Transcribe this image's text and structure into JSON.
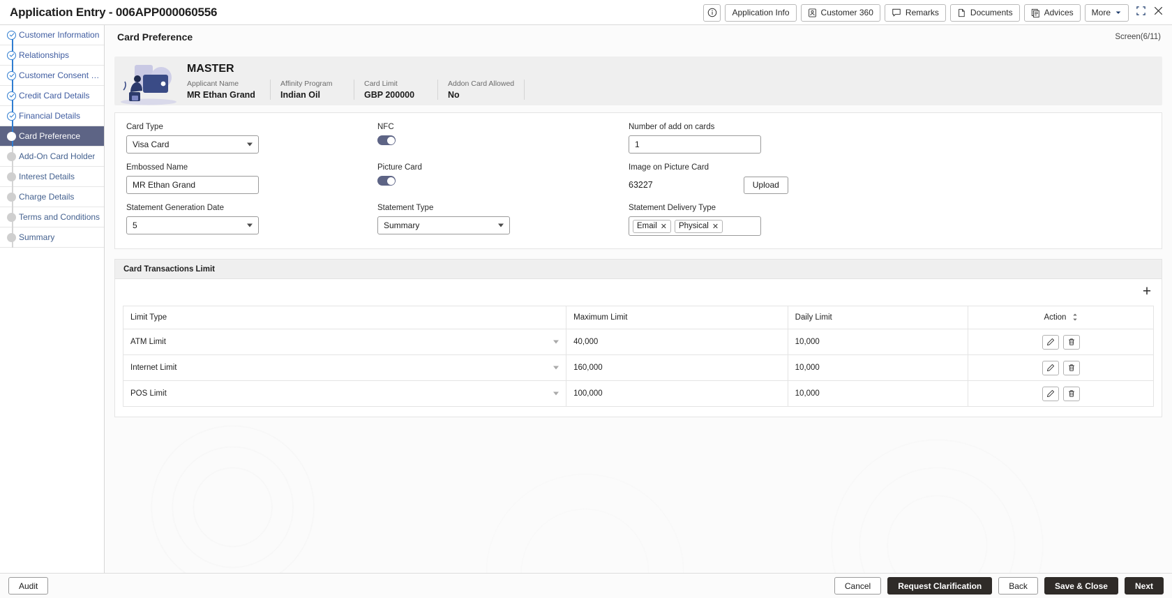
{
  "titlebar": {
    "title": "Application Entry - 006APP000060556",
    "buttons": [
      {
        "label": "",
        "icon": "info-icon",
        "icon_only": true
      },
      {
        "label": "Application Info",
        "icon": "",
        "icon_only": false
      },
      {
        "label": "Customer 360",
        "icon": "user-icon",
        "icon_only": false
      },
      {
        "label": "Remarks",
        "icon": "chat-icon",
        "icon_only": false
      },
      {
        "label": "Documents",
        "icon": "document-icon",
        "icon_only": false
      },
      {
        "label": "Advices",
        "icon": "pages-icon",
        "icon_only": false
      },
      {
        "label": "More",
        "icon": "chevron-down-icon",
        "icon_only": false
      }
    ],
    "window_controls": [
      "minimize-restore-icon",
      "close-icon"
    ]
  },
  "sidebar": {
    "items": [
      {
        "label": "Customer Information",
        "state": "done"
      },
      {
        "label": "Relationships",
        "state": "done"
      },
      {
        "label": "Customer Consent and  ...",
        "state": "done"
      },
      {
        "label": "Credit Card Details",
        "state": "done"
      },
      {
        "label": "Financial Details",
        "state": "done"
      },
      {
        "label": "Card Preference",
        "state": "active"
      },
      {
        "label": "Add-On Card Holder",
        "state": "pending"
      },
      {
        "label": "Interest Details",
        "state": "pending"
      },
      {
        "label": "Charge Details",
        "state": "pending"
      },
      {
        "label": "Terms and Conditions",
        "state": "pending"
      },
      {
        "label": "Summary",
        "state": "pending"
      }
    ]
  },
  "page": {
    "title": "Card Preference",
    "screen_indicator": "Screen(6/11)"
  },
  "master": {
    "name": "MASTER",
    "fields": [
      {
        "label": "Applicant Name",
        "value": "MR Ethan Grand"
      },
      {
        "label": "Affinity Program",
        "value": "Indian Oil"
      },
      {
        "label": "Card Limit",
        "value": "GBP 200000"
      },
      {
        "label": "Addon Card Allowed",
        "value": "No"
      }
    ]
  },
  "form": {
    "card_type": {
      "label": "Card Type",
      "value": "Visa Card"
    },
    "nfc": {
      "label": "NFC",
      "on": true
    },
    "num_addon_cards": {
      "label": "Number of add on cards",
      "value": "1"
    },
    "embossed_name": {
      "label": "Embossed Name",
      "value": "MR Ethan Grand"
    },
    "picture_card": {
      "label": "Picture Card",
      "on": true
    },
    "image_on_picture_card": {
      "label": "Image on Picture Card",
      "value": "63227",
      "upload_label": "Upload"
    },
    "statement_generation_date": {
      "label": "Statement Generation Date",
      "value": "5"
    },
    "statement_type": {
      "label": "Statement Type",
      "value": "Summary"
    },
    "statement_delivery_type": {
      "label": "Statement Delivery Type",
      "chips": [
        "Email",
        "Physical"
      ]
    }
  },
  "table": {
    "section_title": "Card Transactions Limit",
    "add_icon": "plus-icon",
    "columns": [
      "Limit Type",
      "Maximum Limit",
      "Daily Limit",
      "Action"
    ],
    "rows": [
      {
        "limit_type": "ATM Limit",
        "maximum_limit": "40,000",
        "daily_limit": "10,000"
      },
      {
        "limit_type": "Internet Limit",
        "maximum_limit": "160,000",
        "daily_limit": "10,000"
      },
      {
        "limit_type": "POS Limit",
        "maximum_limit": "100,000",
        "daily_limit": "10,000"
      }
    ],
    "row_actions": [
      "edit-icon",
      "delete-icon"
    ]
  },
  "footer": {
    "audit_label": "Audit",
    "cancel_label": "Cancel",
    "request_clarification_label": "Request Clarification",
    "back_label": "Back",
    "save_close_label": "Save & Close",
    "next_label": "Next"
  },
  "colors": {
    "accent_active": "#5d6485",
    "nav_link": "#3f5ca0",
    "step_done": "#2f7dd1",
    "dark_button": "#2f2b28"
  }
}
